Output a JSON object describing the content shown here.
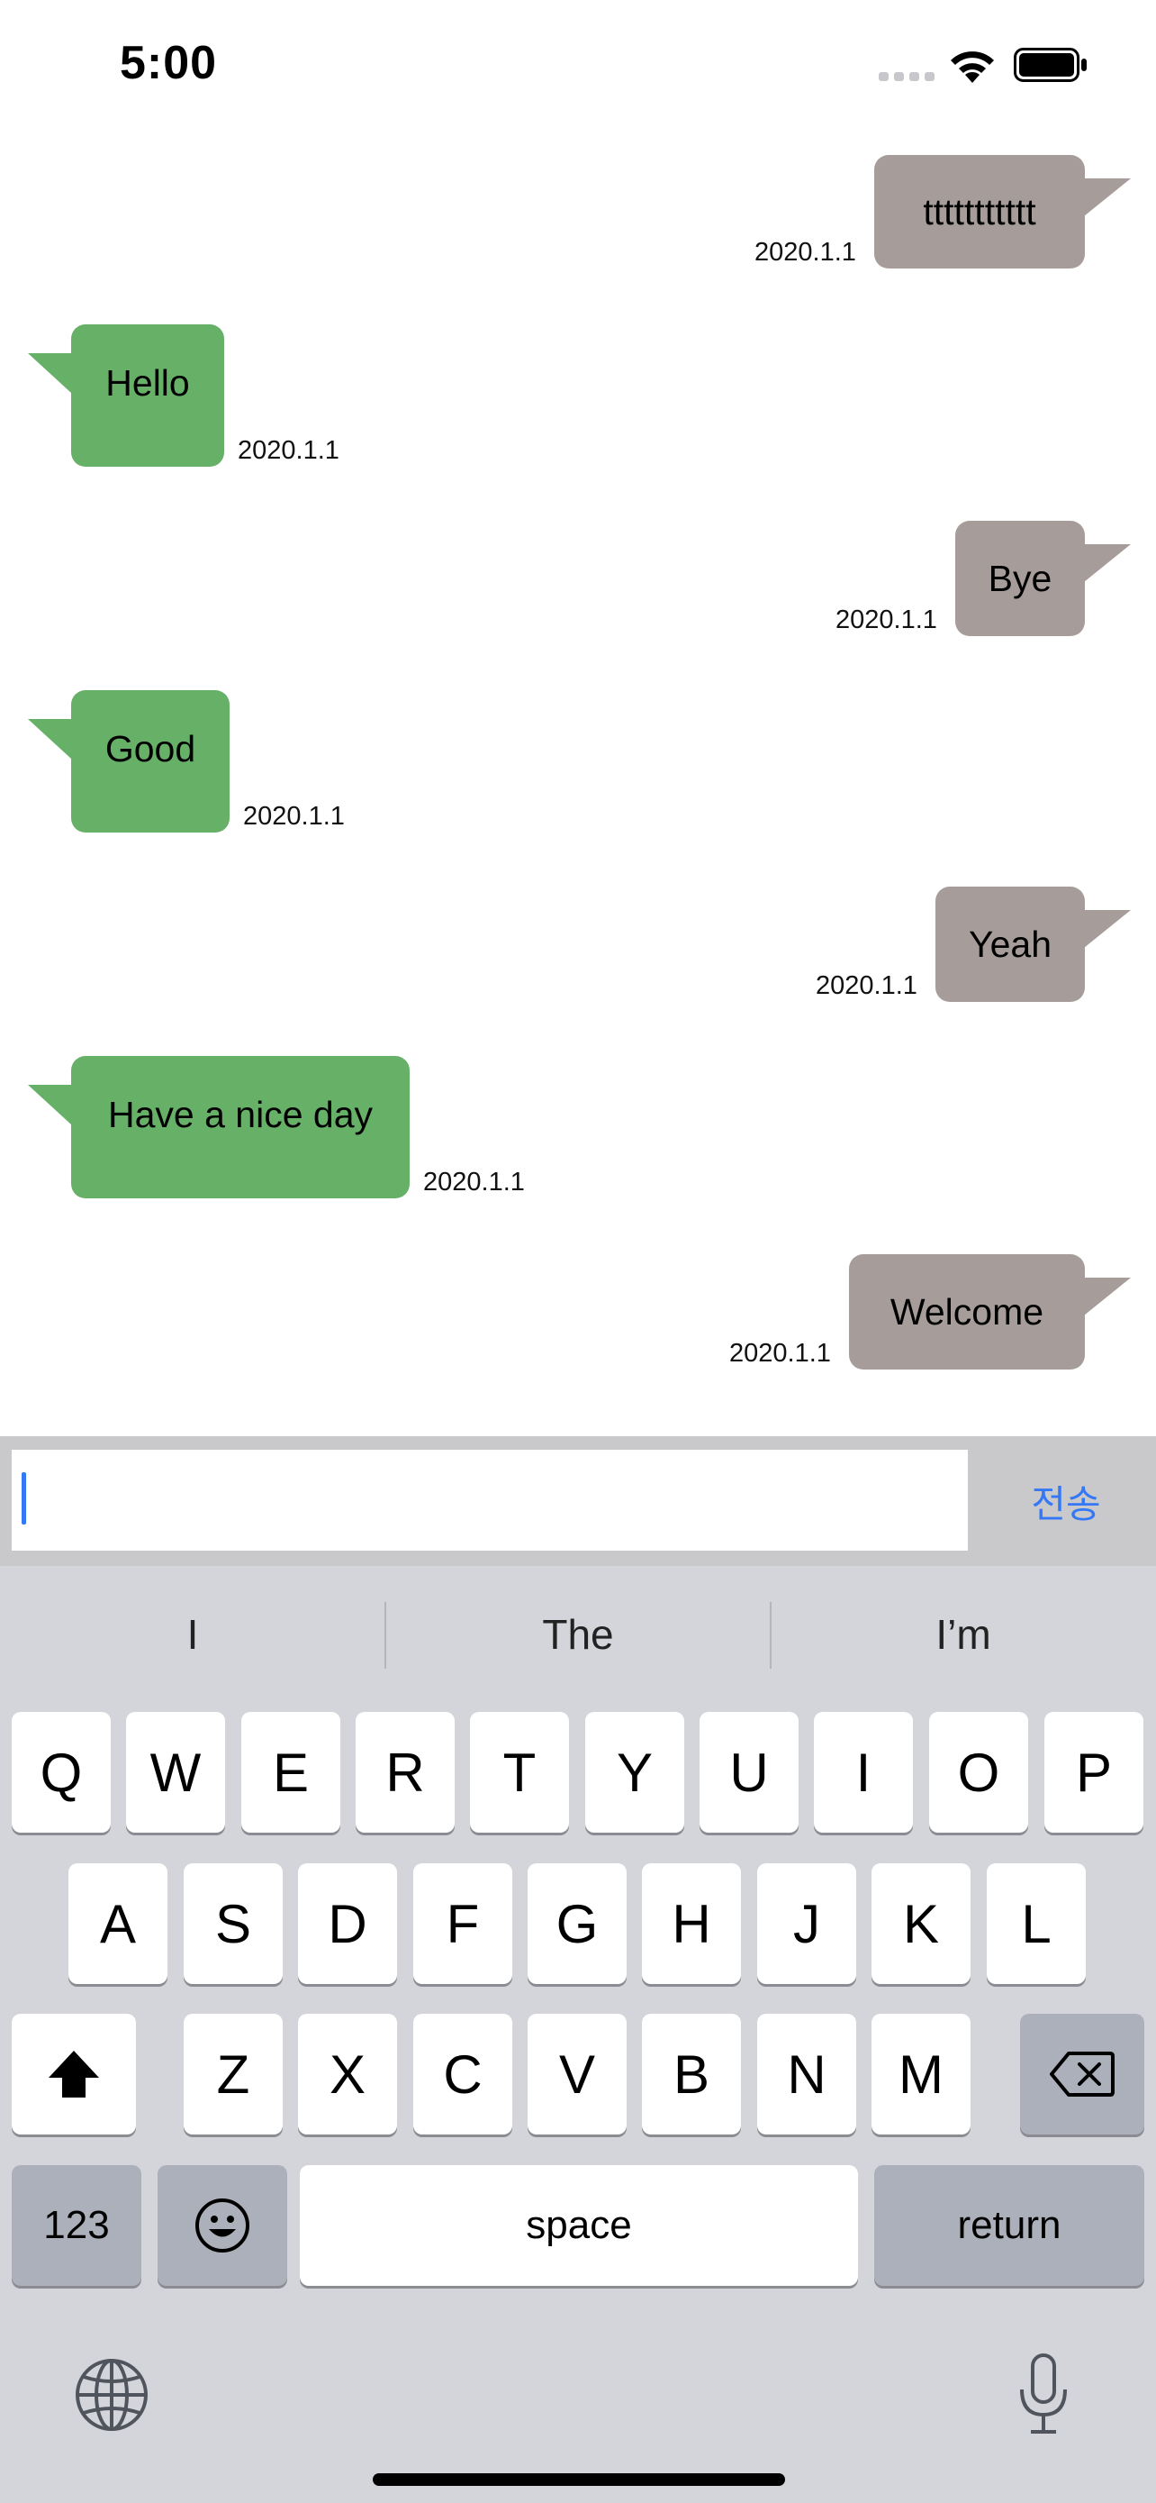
{
  "status_bar": {
    "time": "5:00"
  },
  "messages": [
    {
      "side": "out",
      "text": "ttttttttttt",
      "time": "2020.1.1"
    },
    {
      "side": "in",
      "text": "Hello",
      "time": "2020.1.1"
    },
    {
      "side": "out",
      "text": "Bye",
      "time": "2020.1.1"
    },
    {
      "side": "in",
      "text": "Good",
      "time": "2020.1.1"
    },
    {
      "side": "out",
      "text": "Yeah",
      "time": "2020.1.1"
    },
    {
      "side": "in",
      "text": "Have a nice day",
      "time": "2020.1.1"
    },
    {
      "side": "out",
      "text": "Welcome",
      "time": "2020.1.1"
    }
  ],
  "input_bar": {
    "value": "",
    "placeholder": "",
    "send_label": "전송"
  },
  "keyboard": {
    "suggestions": [
      "I",
      "The",
      "I’m"
    ],
    "row1": [
      "Q",
      "W",
      "E",
      "R",
      "T",
      "Y",
      "U",
      "I",
      "O",
      "P"
    ],
    "row2": [
      "A",
      "S",
      "D",
      "F",
      "G",
      "H",
      "J",
      "K",
      "L"
    ],
    "row3": [
      "Z",
      "X",
      "C",
      "V",
      "B",
      "N",
      "M"
    ],
    "numbers_label": "123",
    "space_label": "space",
    "return_label": "return"
  },
  "colors": {
    "outgoing_bubble": "#a69c99",
    "incoming_bubble": "#66b067",
    "accent": "#3478f6",
    "keyboard_bg": "#d4d5db"
  }
}
